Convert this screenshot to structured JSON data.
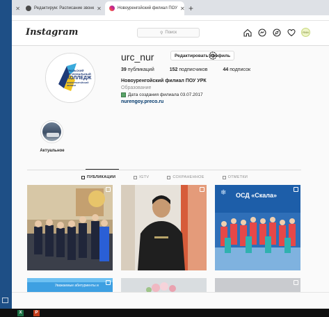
{
  "browser": {
    "tabs": [
      {
        "label": "",
        "active": false
      },
      {
        "label": "Редактирум: Расписание звонк",
        "active": false
      },
      {
        "label": "Новоуренгойский филиал ПОУ",
        "active": true
      }
    ],
    "new_tab": "+"
  },
  "header": {
    "logo": "Instagram",
    "search_placeholder": "Поиск",
    "avatar_text": "RNN"
  },
  "profile": {
    "username": "urc_nur",
    "edit_button": "Редактировать профиль",
    "posts_count": "39",
    "posts_label": "публикаций",
    "followers_count": "152",
    "followers_label": "подписчиков",
    "following_count": "44",
    "following_label": "подписок",
    "full_name": "Новоуренгойский филиал ПОУ УРК",
    "category": "Образование",
    "created": "Дата создания филиала 03.07.2017",
    "link": "nurengoy.preco.ru",
    "logo_lines": [
      "УРАЛЬСКИЙ",
      "РЕГИОНАЛЬНЫЙ",
      "КОЛЛЕДЖ",
      "НОВОУРЕНГОЙСКИЙ ФИЛИАЛ"
    ]
  },
  "highlight": {
    "label": "Актуальное"
  },
  "profile_tabs": [
    {
      "label": "ПУБЛИКАЦИИ",
      "icon": "grid-icon",
      "active": true
    },
    {
      "label": "IGTV",
      "icon": "tv-icon",
      "active": false
    },
    {
      "label": "СОХРАНЕННОЕ",
      "icon": "bookmark-icon",
      "active": false
    },
    {
      "label": "ОТМЕТКИ",
      "icon": "tag-icon",
      "active": false
    }
  ],
  "posts": {
    "post3_title": "ОСД «Скала»",
    "post4_caption": "Уважаемые абитуриенты и"
  },
  "colors": {
    "accent": "#0095f6",
    "link": "#00376b",
    "desktop_bg": "#1e4f86"
  }
}
